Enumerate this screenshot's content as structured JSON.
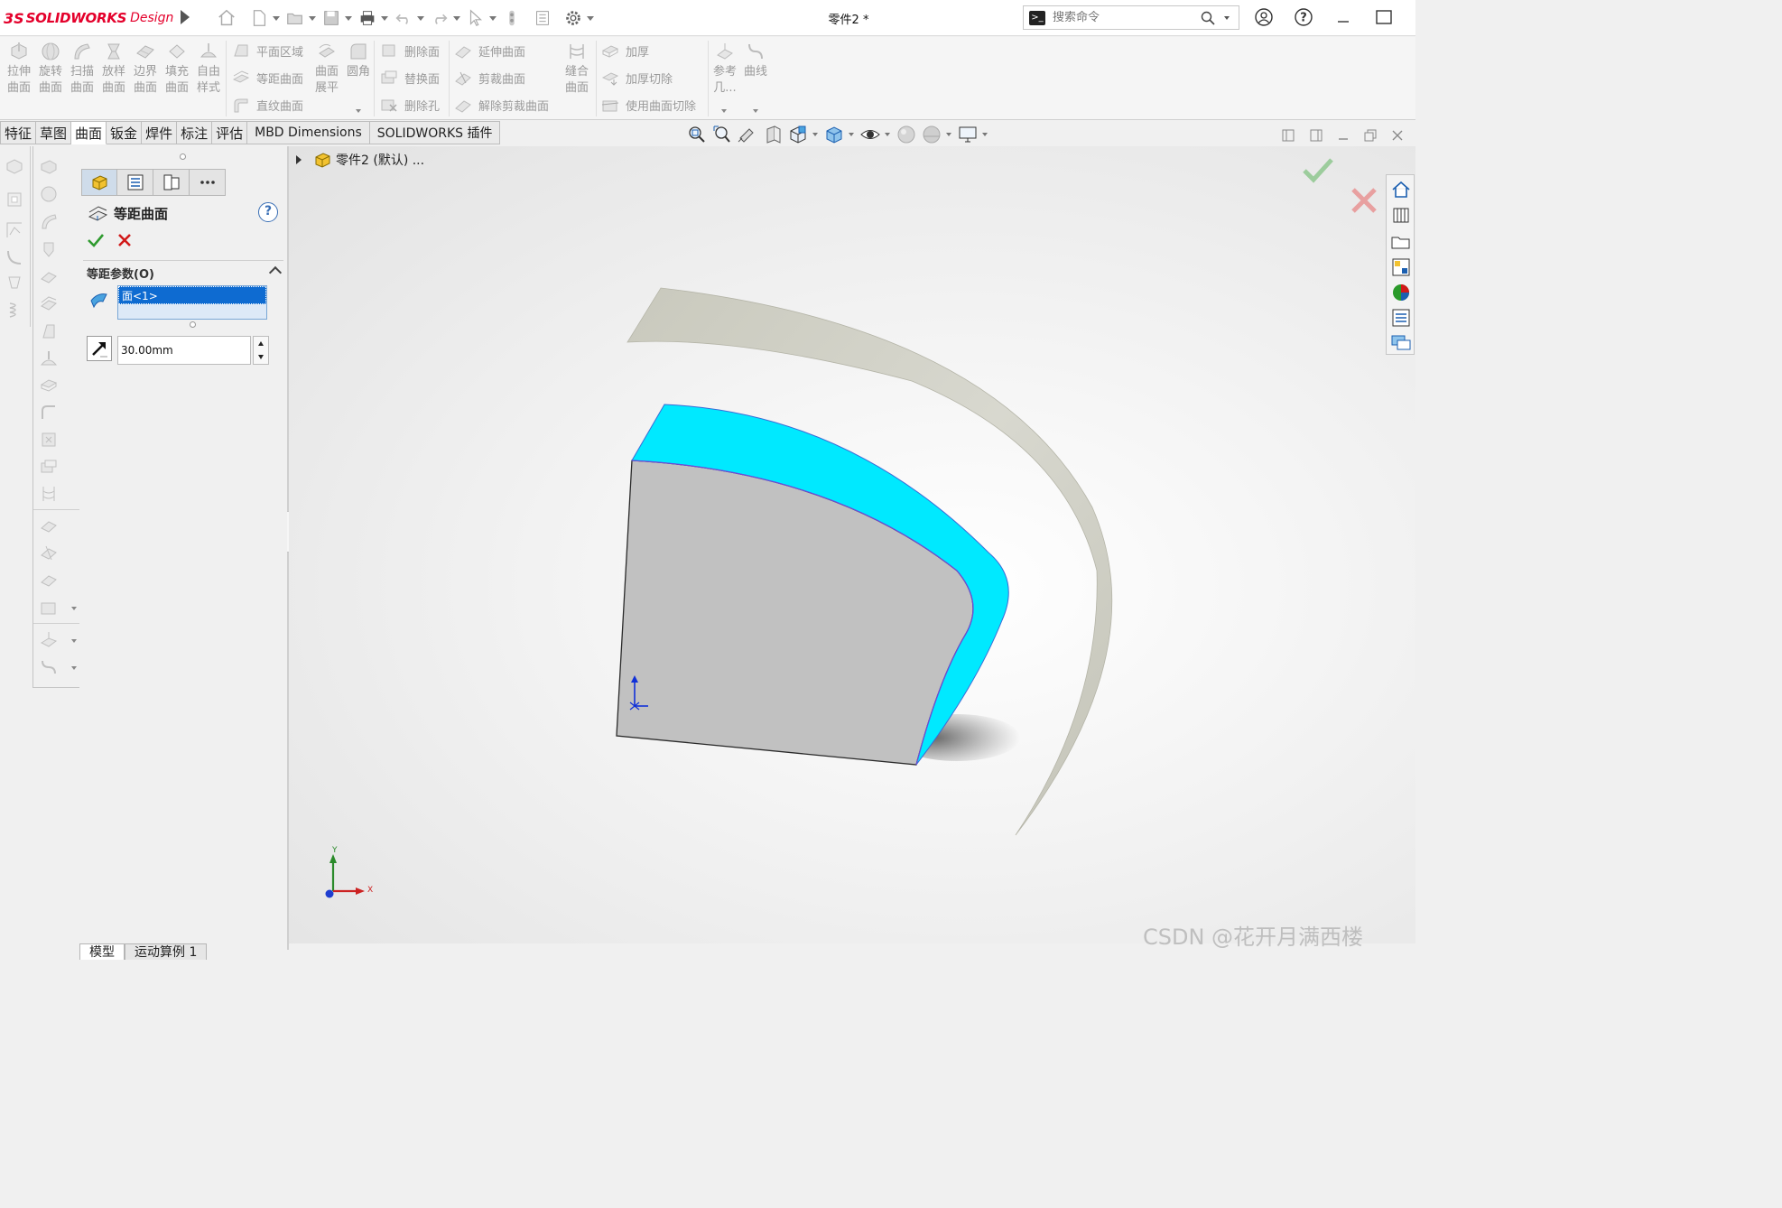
{
  "app": {
    "logo_ds": "3S",
    "brand": "SOLIDWORKS",
    "edition": "Design",
    "document_title": "零件2 *"
  },
  "search": {
    "placeholder": "搜索命令"
  },
  "ribbon": {
    "big_buttons": [
      {
        "line1": "拉伸",
        "line2": "曲面",
        "icon": "extrude-surface-icon"
      },
      {
        "line1": "旋转",
        "line2": "曲面",
        "icon": "revolve-surface-icon"
      },
      {
        "line1": "扫描",
        "line2": "曲面",
        "icon": "sweep-surface-icon"
      },
      {
        "line1": "放样",
        "line2": "曲面",
        "icon": "loft-surface-icon"
      },
      {
        "line1": "边界",
        "line2": "曲面",
        "icon": "boundary-surface-icon"
      },
      {
        "line1": "填充",
        "line2": "曲面",
        "icon": "fill-surface-icon"
      },
      {
        "line1": "自由",
        "line2": "样式",
        "icon": "freeform-icon"
      }
    ],
    "col_planar": [
      "平面区域",
      "等距曲面",
      "直纹曲面"
    ],
    "flatten": {
      "line1": "曲面",
      "line2": "展平"
    },
    "fillet": "圆角",
    "col_delete": [
      "删除面",
      "替换面",
      "删除孔"
    ],
    "col_extend": [
      "延伸曲面",
      "剪裁曲面",
      "解除剪裁曲面"
    ],
    "knit": {
      "line1": "缝合",
      "line2": "曲面"
    },
    "col_thicken": [
      "加厚",
      "加厚切除",
      "使用曲面切除"
    ],
    "ref_geom": {
      "line1": "参考",
      "line2": "几..."
    },
    "curves": "曲线"
  },
  "tabs": [
    {
      "label": "特征"
    },
    {
      "label": "草图"
    },
    {
      "label": "曲面",
      "active": true
    },
    {
      "label": "钣金"
    },
    {
      "label": "焊件"
    },
    {
      "label": "标注"
    },
    {
      "label": "评估"
    },
    {
      "label": "MBD Dimensions"
    },
    {
      "label": "SOLIDWORKS 插件"
    }
  ],
  "property_manager": {
    "title": "等距曲面",
    "help": "?",
    "group_title": "等距参数(O)",
    "selected_face": "面<1>",
    "distance": "30.00mm"
  },
  "tree": {
    "part_label": "零件2 (默认) ..."
  },
  "triad": {
    "x": "X",
    "y": "Y"
  },
  "bottom_tabs": [
    {
      "label": "模型",
      "active": true
    },
    {
      "label": "运动算例 1"
    }
  ],
  "watermark": "CSDN @花开月满西楼",
  "colors": {
    "accent_blue": "#0e6bd1",
    "brand_red": "#e4002b",
    "offset_face": "#00e5ff",
    "part_gray": "#c0c0c0",
    "offset_surface": "#d3d3c8"
  }
}
